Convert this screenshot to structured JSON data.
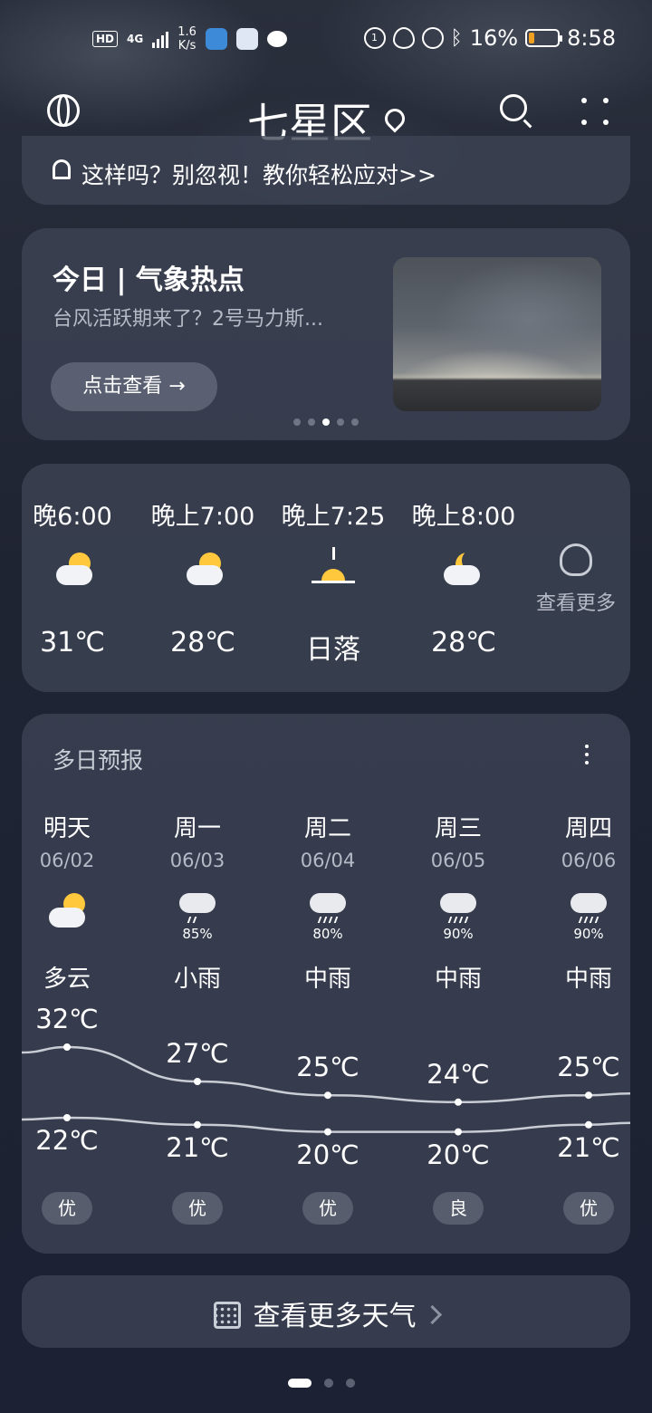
{
  "status_bar": {
    "net_tag": "HD",
    "net_type": "4G",
    "speed": "1.6",
    "speed_unit": "K/s",
    "battery": "16%",
    "time": "8:58"
  },
  "header": {
    "city": "七星区"
  },
  "notice": {
    "text": "这样吗？别忽视！教你轻松应对>>"
  },
  "hot_topic": {
    "title": "今日 | 气象热点",
    "subtitle": "台风活跃期来了？2号马力斯...",
    "button": "点击查看 →",
    "page_count": 5,
    "active_page": 2
  },
  "hourly": {
    "items": [
      {
        "time": "晚6:00",
        "temp": "31℃",
        "icon": "partly-cloudy-icon"
      },
      {
        "time": "晚上7:00",
        "temp": "28℃",
        "icon": "partly-cloudy-icon"
      },
      {
        "time": "晚上7:25",
        "temp": "日落",
        "icon": "sunset-icon"
      },
      {
        "time": "晚上8:00",
        "temp": "28℃",
        "icon": "cloudy-night-icon"
      }
    ],
    "see_more": "查看更多"
  },
  "daily": {
    "title": "多日预报",
    "days": [
      {
        "day": "明天",
        "date": "06/02",
        "cond": "多云",
        "pop": "",
        "hi": "32℃",
        "lo": "22℃",
        "aqi": "优",
        "hi_v": 32,
        "lo_v": 22,
        "icon": "partly-cloudy-icon"
      },
      {
        "day": "周一",
        "date": "06/03",
        "cond": "小雨",
        "pop": "85%",
        "hi": "27℃",
        "lo": "21℃",
        "aqi": "优",
        "hi_v": 27,
        "lo_v": 21,
        "icon": "light-rain-icon"
      },
      {
        "day": "周二",
        "date": "06/04",
        "cond": "中雨",
        "pop": "80%",
        "hi": "25℃",
        "lo": "20℃",
        "aqi": "优",
        "hi_v": 25,
        "lo_v": 20,
        "icon": "moderate-rain-icon"
      },
      {
        "day": "周三",
        "date": "06/05",
        "cond": "中雨",
        "pop": "90%",
        "hi": "24℃",
        "lo": "20℃",
        "aqi": "良",
        "hi_v": 24,
        "lo_v": 20,
        "icon": "moderate-rain-icon"
      },
      {
        "day": "周四",
        "date": "06/06",
        "cond": "中雨",
        "pop": "90%",
        "hi": "25℃",
        "lo": "21℃",
        "aqi": "优",
        "hi_v": 25,
        "lo_v": 21,
        "icon": "moderate-rain-icon"
      }
    ]
  },
  "more_weather": {
    "label": "查看更多天气"
  },
  "pager": {
    "count": 3,
    "active": 0
  },
  "colors": {
    "battery_low": "#f0a020",
    "sun": "#ffc83d",
    "card": "#3e4454"
  }
}
